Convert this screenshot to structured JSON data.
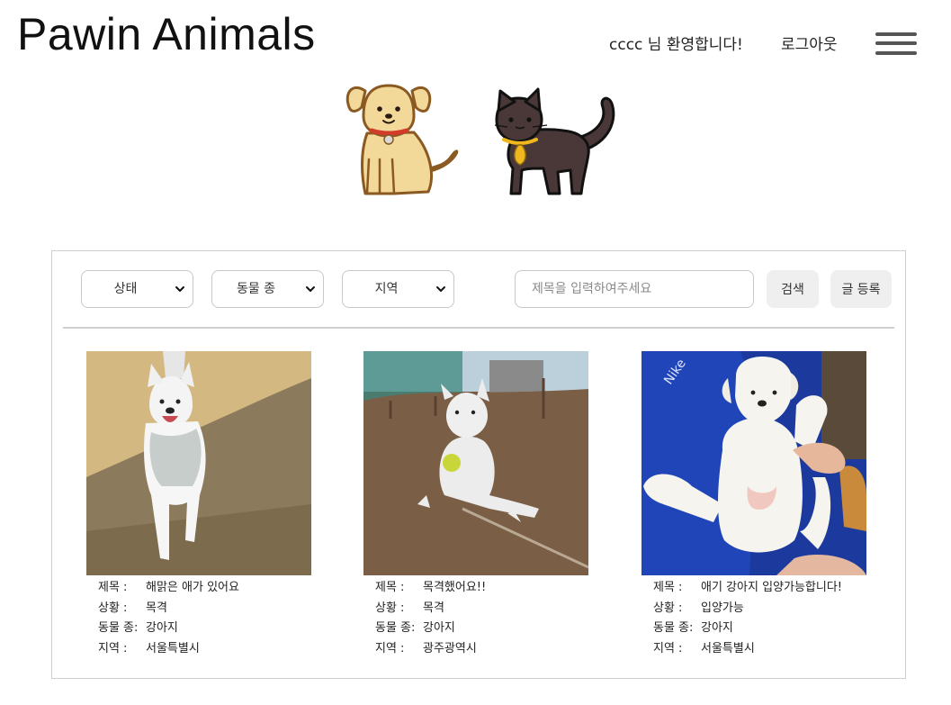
{
  "header": {
    "brand": "Pawin Animals",
    "welcome": "cccc 님 환영합니다!",
    "logout": "로그아웃"
  },
  "filters": {
    "status": "상태",
    "species": "동물 종",
    "region": "지역",
    "search_placeholder": "제목을 입력하여주세요",
    "search_button": "검색",
    "write_button": "글 등록"
  },
  "labels": {
    "title": "제목 :",
    "status": "상황 :",
    "species": "동물 종:",
    "region": "지역 :"
  },
  "posts": [
    {
      "title": "해맑은 애가 있어요",
      "status": "목격",
      "species": "강아지",
      "region": "서울특별시"
    },
    {
      "title": "목격했어요!!",
      "status": "목격",
      "species": "강아지",
      "region": "광주광역시"
    },
    {
      "title": "애기 강아지 입양가능합니다!",
      "status": "입양가능",
      "species": "강아지",
      "region": "서울특별시"
    }
  ],
  "icons": {
    "menu": "hamburger-icon",
    "dropdown": "chevron-down-icon",
    "dog": "dog-mascot-icon",
    "cat": "cat-mascot-icon"
  },
  "colors": {
    "dog_fur": "#f2d99a",
    "dog_outline": "#8a5a22",
    "collar": "#d23a2a",
    "cat_fur": "#4a3838",
    "bell": "#f0b81e"
  }
}
